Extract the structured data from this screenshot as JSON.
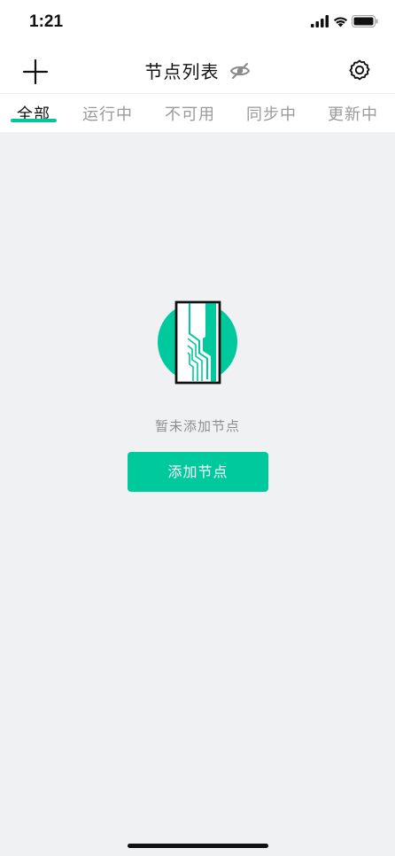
{
  "status_bar": {
    "time": "1:21"
  },
  "nav": {
    "title": "节点列表",
    "icons": {
      "add": "plus-icon",
      "visibility": "eye-off-icon",
      "settings": "gear-icon"
    }
  },
  "tabs": [
    {
      "label": "全部",
      "active": true
    },
    {
      "label": "运行中",
      "active": false
    },
    {
      "label": "不可用",
      "active": false
    },
    {
      "label": "同步中",
      "active": false
    },
    {
      "label": "更新中",
      "active": false
    }
  ],
  "empty_state": {
    "message": "暂未添加节点",
    "button_label": "添加节点",
    "illustration": "node-empty-illustration"
  },
  "colors": {
    "accent": "#00c99d",
    "background": "#f0f1f3",
    "tab_inactive": "#9a9a9a"
  }
}
